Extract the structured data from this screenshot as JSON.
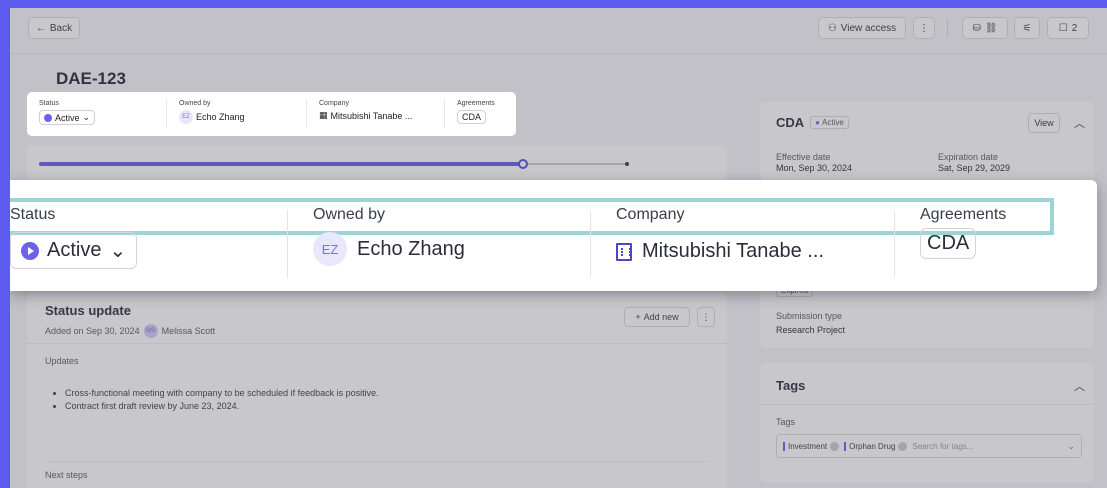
{
  "topbar": {
    "back_label": "Back",
    "view_access_label": "View access",
    "more_label": "⋮",
    "comments_count": "2"
  },
  "page": {
    "title": "DAE-123"
  },
  "info": {
    "status_label": "Status",
    "status_value": "Active",
    "owner_label": "Owned by",
    "owner_initials": "EZ",
    "owner_name": "Echo Zhang",
    "company_label": "Company",
    "company_name": "Mitsubishi Tanabe ...",
    "agreements_label": "Agreements",
    "agreements_value": "CDA"
  },
  "progress": {
    "fraction": 0.82
  },
  "status_update": {
    "title": "Status update",
    "added_on": "Added on Sep 30, 2024",
    "author_initials": "MS",
    "author": "Melissa Scott",
    "add_new_label": "Add new",
    "updates_label": "Updates",
    "updates": [
      "Cross-functional meeting with company to be scheduled if feedback is positive.",
      "Contract first draft review by June 23, 2024."
    ],
    "next_steps_label": "Next steps"
  },
  "cda_panel": {
    "title": "CDA",
    "badge": "Active",
    "view_label": "View",
    "effective_label": "Effective date",
    "effective_value": "Mon, Sep 30, 2024",
    "expiration_label": "Expiration date",
    "expiration_value": "Sat, Sep 29, 2029"
  },
  "second_panel": {
    "badge": "Expired",
    "submission_label": "Submission type",
    "submission_value": "Research Project"
  },
  "tags_panel": {
    "title": "Tags",
    "field_label": "Tags",
    "tags": [
      "Investment",
      "Orphan Drug"
    ],
    "placeholder": "Search for tags..."
  },
  "colors": {
    "accent": "#6259e6",
    "frame": "#5b5bef",
    "highlight": "#9dd4d5"
  }
}
